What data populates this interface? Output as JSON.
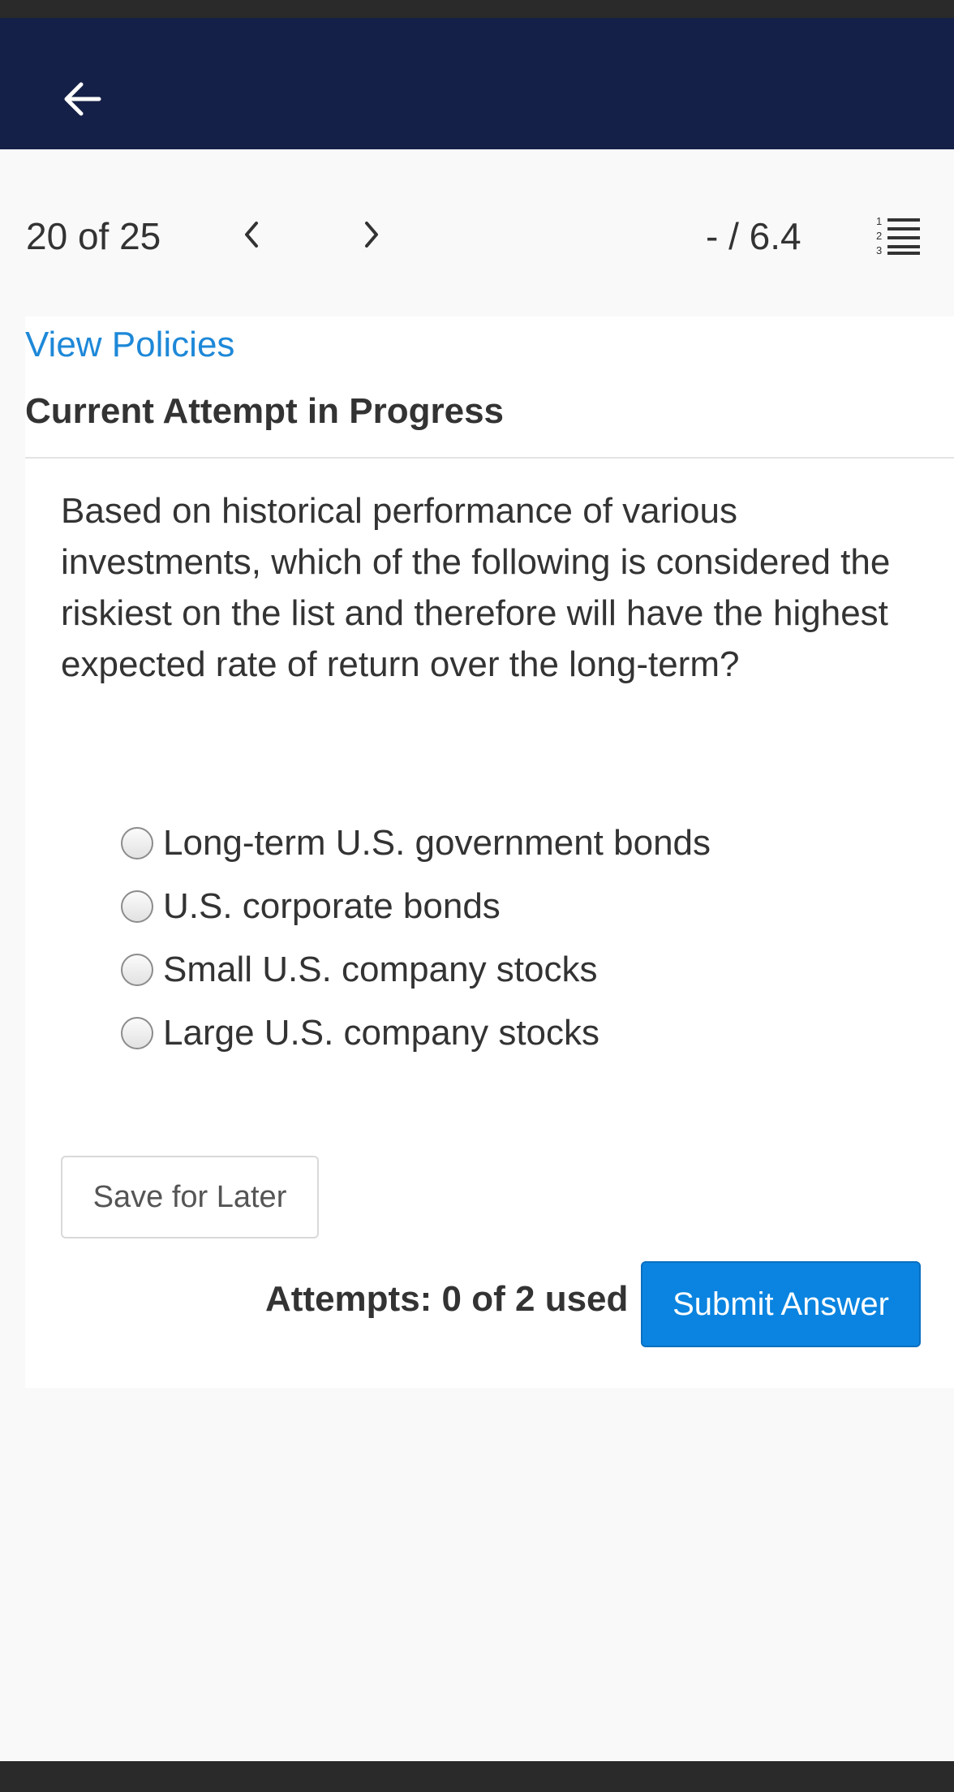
{
  "header": {
    "back_icon": "arrow-left-icon",
    "bg_color": "#142047"
  },
  "nav": {
    "counter": "20 of 25",
    "prev_icon": "chevron-left-icon",
    "next_icon": "chevron-right-icon",
    "score": "- / 6.4",
    "list_icon": "numbered-list-icon"
  },
  "card": {
    "policies_link": "View Policies",
    "attempt_title": "Current Attempt in Progress",
    "question": "Based on historical performance of various investments, which of the following is considered the riskiest on the list and therefore will have the highest expected rate of return over the long-term?",
    "options": [
      {
        "label": "Long-term U.S. government bonds"
      },
      {
        "label": "U.S. corporate bonds"
      },
      {
        "label": "Small U.S. company stocks"
      },
      {
        "label": "Large U.S. company stocks"
      }
    ],
    "save_label": "Save for Later",
    "attempts": "Attempts: 0 of 2 used",
    "submit_label": "Submit Answer"
  },
  "colors": {
    "accent": "#0a84e0",
    "link": "#1e88d8"
  }
}
